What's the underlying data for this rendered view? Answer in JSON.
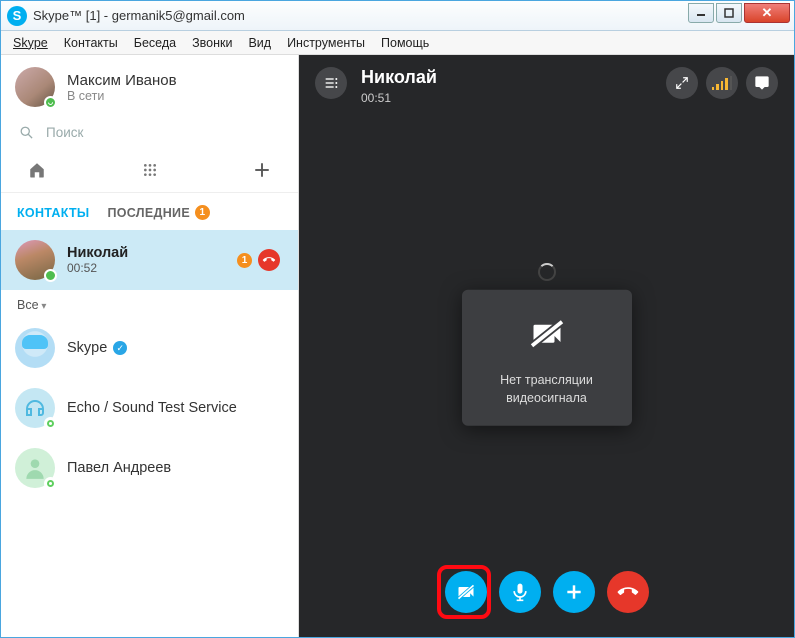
{
  "window": {
    "title": "Skype™ [1] - germanik5@gmail.com",
    "logo_letter": "S"
  },
  "menu": {
    "items": [
      "Skype",
      "Контакты",
      "Беседа",
      "Звонки",
      "Вид",
      "Инструменты",
      "Помощь"
    ]
  },
  "profile": {
    "name": "Максим Иванов",
    "status": "В сети"
  },
  "search": {
    "placeholder": "Поиск"
  },
  "tabs": {
    "contacts": "КОНТАКТЫ",
    "recent": "ПОСЛЕДНИЕ",
    "recent_badge": "1"
  },
  "active_contact": {
    "name": "Николай",
    "duration": "00:52",
    "badge": "1"
  },
  "filter": {
    "label": "Все"
  },
  "contacts": [
    {
      "name": "Skype",
      "verified": true
    },
    {
      "name": "Echo / Sound Test Service"
    },
    {
      "name": "Павел Андреев"
    }
  ],
  "call": {
    "title": "Николай",
    "timer": "00:51",
    "video_status_line1": "Нет трансляции",
    "video_status_line2": "видеосигнала"
  }
}
